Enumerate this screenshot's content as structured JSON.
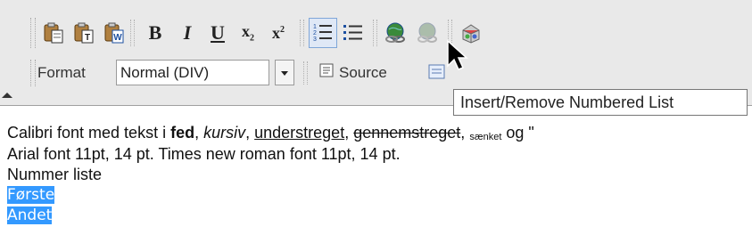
{
  "toolbar": {
    "row1": {
      "paste_icon": "paste-icon",
      "paste_text_icon": "paste-text-icon",
      "paste_word_icon": "paste-from-word-icon",
      "bold": "B",
      "italic": "I",
      "underline": "U",
      "subscript": "x",
      "subscript_index": "2",
      "superscript": "x",
      "superscript_index": "2",
      "numbered_list_icon": "numbered-list-icon",
      "bulleted_list_icon": "bulleted-list-icon",
      "link_icon": "link-icon",
      "unlink_icon": "unlink-icon",
      "flash_icon": "flash-object-icon"
    },
    "row2": {
      "format_label": "Format",
      "format_value": "Normal (DIV)",
      "source_label": "Source"
    }
  },
  "tooltip": "Insert/Remove Numbered List",
  "editor": {
    "line1": {
      "a": "Calibri font med tekst i ",
      "bold": "fed",
      "b": ", ",
      "italic": "kursiv",
      "c": ", ",
      "underline": "understreget",
      "d": ", ",
      "strike": "gennemstreget",
      "e": ", ",
      "sub": "sænket",
      "f": " og \""
    },
    "line2": "Arial font 11pt, 14 pt. Times new roman font 11pt, 14 pt.",
    "line3": "Nummer liste",
    "line4": "Første",
    "line5": "Andet"
  },
  "colors": {
    "selection": "#3399ff",
    "toolbar_bg": "#e9e9e9",
    "active_button": "#dfe8f6"
  }
}
